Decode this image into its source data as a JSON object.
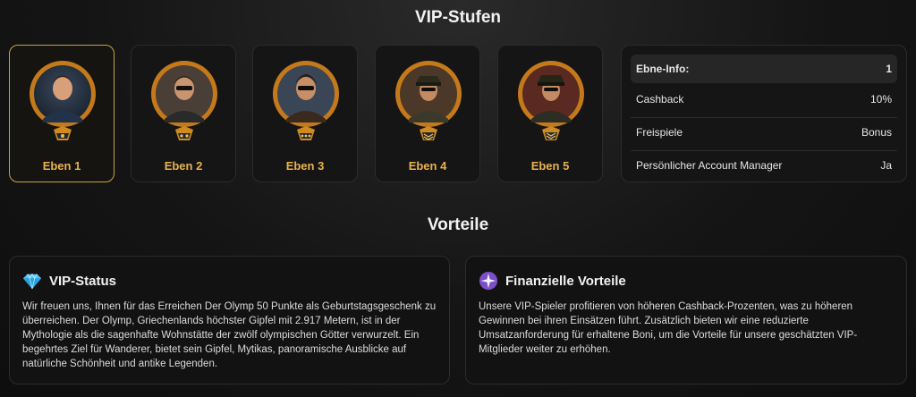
{
  "vip_section": {
    "title": "VIP-Stufen"
  },
  "levels": [
    {
      "label": "Eben 1",
      "active": true
    },
    {
      "label": "Eben 2",
      "active": false
    },
    {
      "label": "Eben 3",
      "active": false
    },
    {
      "label": "Eben 4",
      "active": false
    },
    {
      "label": "Eben 5",
      "active": false
    }
  ],
  "level_info": {
    "header_label": "Ebne-Info:",
    "header_value": "1",
    "rows": [
      {
        "label": "Cashback",
        "value": "10%"
      },
      {
        "label": "Freispiele",
        "value": "Bonus"
      },
      {
        "label": "Persönlicher Account Manager",
        "value": "Ja"
      }
    ]
  },
  "benefits_section": {
    "title": "Vorteile"
  },
  "benefits": [
    {
      "icon": "diamond-icon",
      "title": "VIP-Status",
      "text": "Wir freuen uns, Ihnen für das Erreichen Der Olymp 50 Punkte als Geburtstagsgeschenk zu überreichen. Der Olymp, Griechenlands höchster Gipfel mit 2.917 Metern, ist in der Mythologie als die sagenhafte Wohnstätte der zwölf olympischen Götter verwurzelt. Ein begehrtes Ziel für Wanderer, bietet sein Gipfel, Mytikas, panoramische Ausblicke auf natürliche Schönheit und antike Legenden."
    },
    {
      "icon": "sparkle-badge-icon",
      "title": "Finanzielle Vorteile",
      "text": "Unsere VIP-Spieler profitieren von höheren Cashback-Prozenten, was zu höheren Gewinnen bei ihren Einsätzen führt. Zusätzlich bieten wir eine reduzierte Umsatzanforderung für erhaltene Boni, um die Vorteile für unsere geschätzten VIP-Mitglieder weiter zu erhöhen."
    }
  ],
  "colors": {
    "accent": "#e8b24e",
    "active_border": "#c8a33c",
    "card_bg": "#151515"
  }
}
